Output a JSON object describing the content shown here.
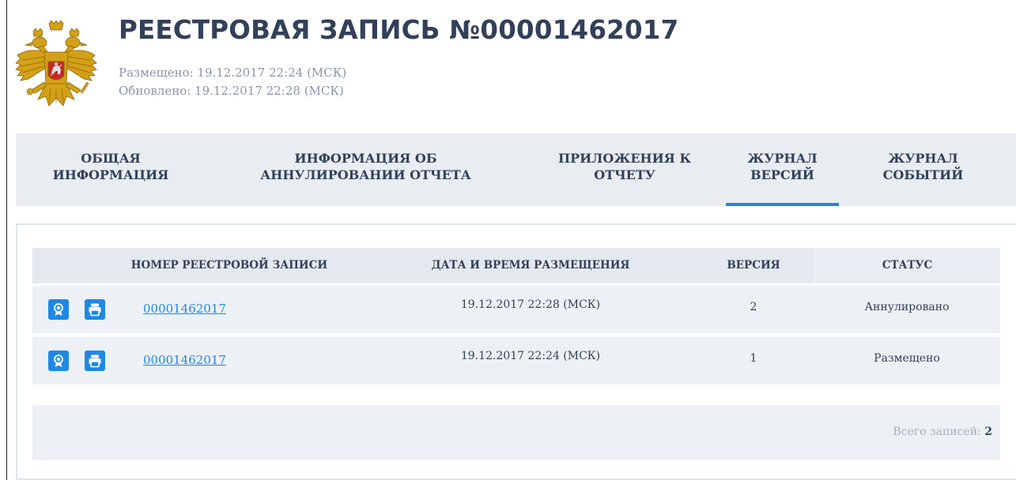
{
  "header": {
    "title": "РЕЕСТРОВАЯ ЗАПИСЬ №00001462017",
    "posted": "Размещено: 19.12.2017 22:24 (МСК)",
    "updated": "Обновлено: 19.12.2017 22:28 (МСК)",
    "emblem_icon": "russia-coat-of-arms-icon"
  },
  "tabs": [
    {
      "line1": "ОБЩАЯ",
      "line2": "ИНФОРМАЦИЯ",
      "active": false
    },
    {
      "line1": "ИНФОРМАЦИЯ ОБ",
      "line2": "АННУЛИРОВАНИИ ОТЧЕТА",
      "active": false
    },
    {
      "line1": "ПРИЛОЖЕНИЯ К",
      "line2": "ОТЧЕТУ",
      "active": false
    },
    {
      "line1": "ЖУРНАЛ",
      "line2": "ВЕРСИЙ",
      "active": true
    },
    {
      "line1": "ЖУРНАЛ",
      "line2": "СОБЫТИЙ",
      "active": false
    }
  ],
  "table": {
    "columns": [
      "НОМЕР РЕЕСТРОВОЙ ЗАПИСИ",
      "ДАТА И ВРЕМЯ РАЗМЕЩЕНИЯ",
      "ВЕРСИЯ",
      "СТАТУС"
    ],
    "rows": [
      {
        "number": "00001462017",
        "datetime": "19.12.2017 22:28 (МСК)",
        "version": "2",
        "status": "Аннулировано",
        "icons": [
          "certificate-icon",
          "print-icon"
        ]
      },
      {
        "number": "00001462017",
        "datetime": "19.12.2017 22:24 (МСК)",
        "version": "1",
        "status": "Размещено",
        "icons": [
          "certificate-icon",
          "print-icon"
        ]
      }
    ]
  },
  "footer": {
    "total_label": "Всего записей:",
    "total_value": "2"
  },
  "colors": {
    "accent": "#1e88e5",
    "text": "#334059",
    "muted": "#8a95a8",
    "tab_bg": "#e9edf2",
    "row_bg": "#edf0f4"
  }
}
